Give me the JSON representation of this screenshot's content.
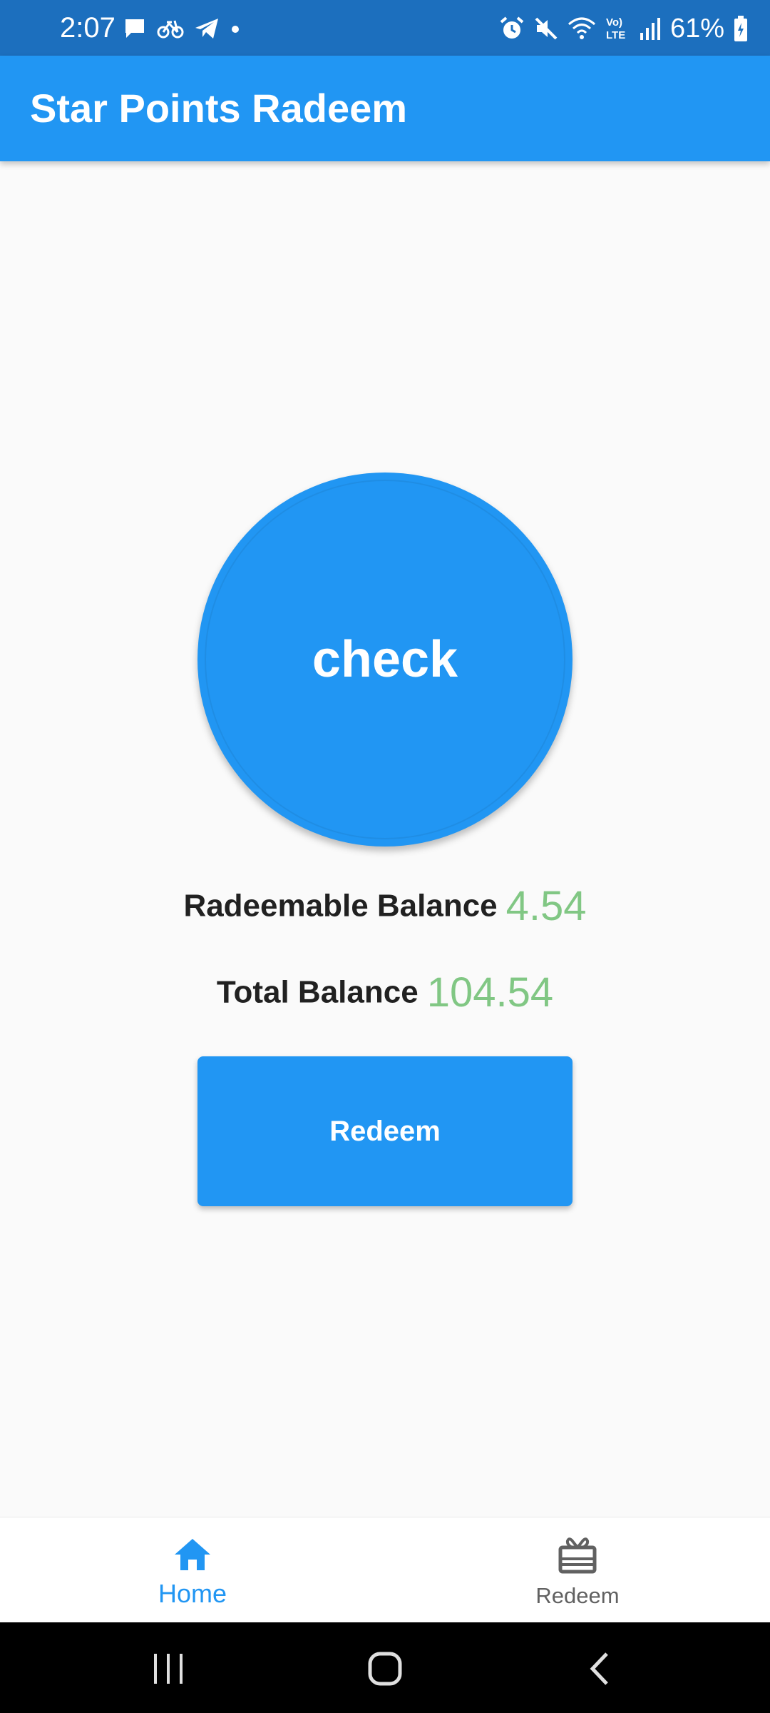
{
  "status_bar": {
    "time": "2:07",
    "battery_percent": "61%",
    "left_icons": [
      "message-icon",
      "bike-icon",
      "telegram-icon",
      "dot-icon"
    ],
    "right_icons": [
      "alarm-icon",
      "mute-icon",
      "wifi-icon",
      "volte-icon",
      "signal-icon",
      "battery-icon"
    ],
    "volte_text": "Vo) LTE"
  },
  "app_bar": {
    "title": "Star Points Radeem"
  },
  "main": {
    "check_label": "check",
    "redeemable_label": "Radeemable Balance",
    "redeemable_value": "4.54",
    "total_label": "Total Balance",
    "total_value": "104.54",
    "redeem_button_label": "Redeem"
  },
  "bottom_nav": {
    "items": [
      {
        "label": "Home",
        "icon": "home-icon",
        "selected": true
      },
      {
        "label": "Redeem",
        "icon": "gift-icon",
        "selected": false
      }
    ]
  },
  "colors": {
    "primary": "#2196f3",
    "status_bar": "#1c6fbe",
    "balance_value": "#81c784",
    "background": "#fafafa"
  }
}
